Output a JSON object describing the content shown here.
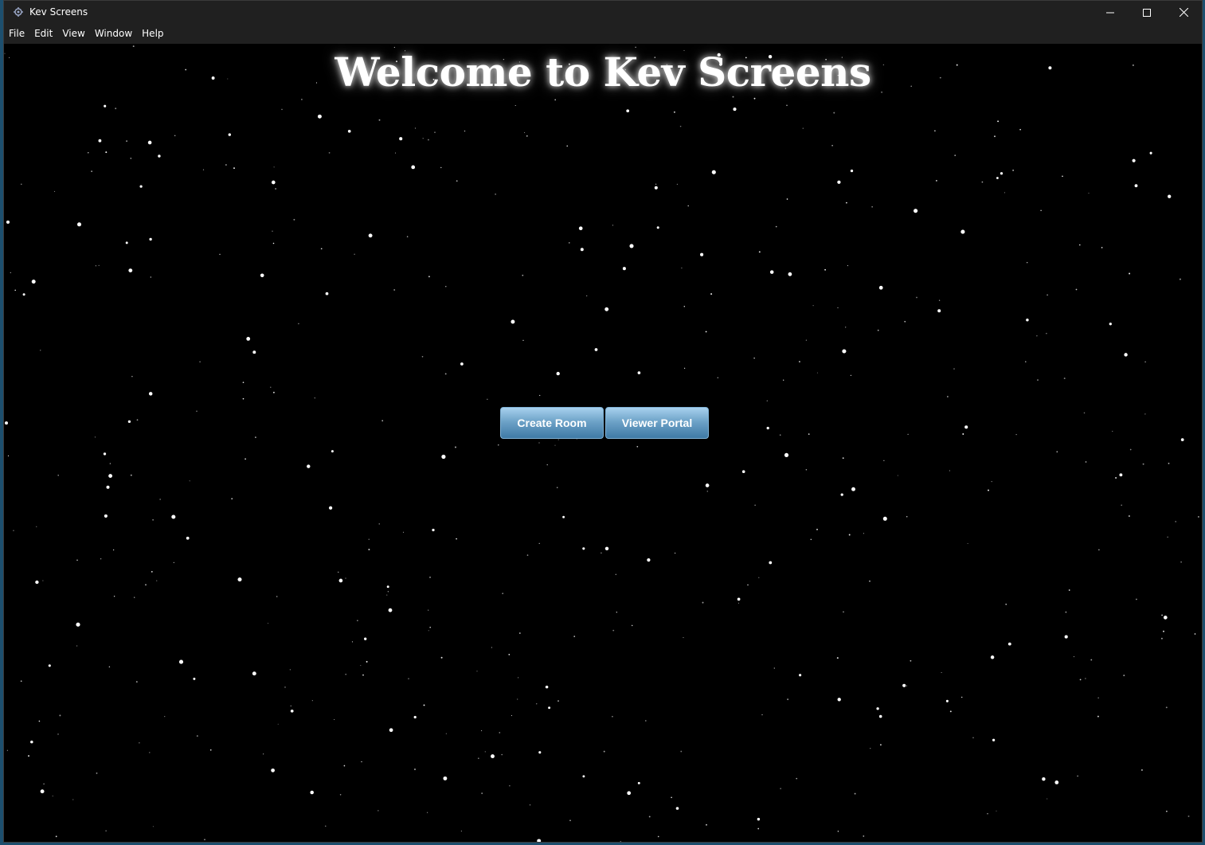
{
  "window": {
    "title": "Kev Screens",
    "app_icon": "gear-icon",
    "controls": [
      "minimize-icon",
      "maximize-icon",
      "close-icon"
    ]
  },
  "menubar": {
    "items": [
      "File",
      "Edit",
      "View",
      "Window",
      "Help"
    ]
  },
  "main": {
    "heading": "Welcome to Kev Screens",
    "buttons": {
      "create_room": "Create Room",
      "viewer_portal": "Viewer Portal"
    }
  },
  "colors": {
    "background": "#000000",
    "titlebar": "#202020",
    "button_top": "#a8d1ee",
    "button_bottom": "#3f7aa6",
    "star": "#ffffff"
  }
}
